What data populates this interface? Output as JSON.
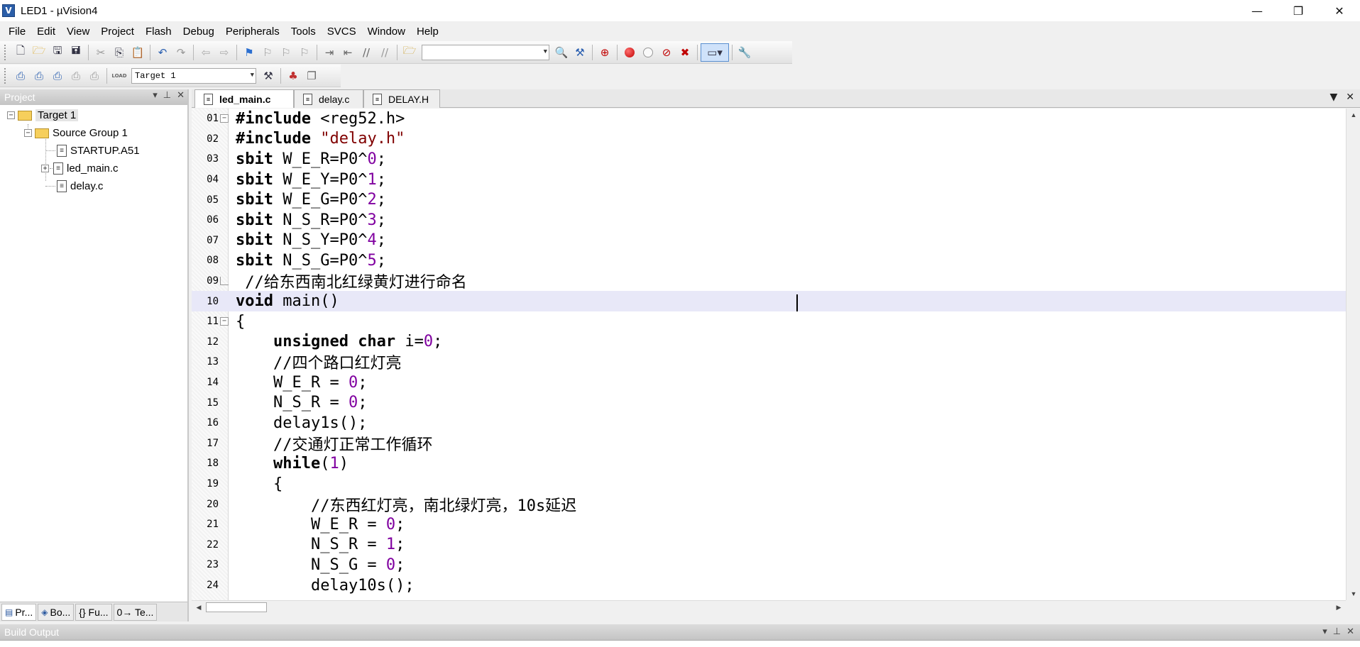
{
  "window": {
    "title": "LED1  - µVision4",
    "icon_letter": "V",
    "controls": {
      "minimize": "—",
      "restore": "❐",
      "close": "✕"
    }
  },
  "menu": [
    "File",
    "Edit",
    "View",
    "Project",
    "Flash",
    "Debug",
    "Peripherals",
    "Tools",
    "SVCS",
    "Window",
    "Help"
  ],
  "toolbar2": {
    "target_select": "Target 1",
    "load_label": "LOAD"
  },
  "project_panel": {
    "title": "Project",
    "tree": {
      "target": "Target 1",
      "group": "Source Group 1",
      "files": [
        "STARTUP.A51",
        "led_main.c",
        "delay.c"
      ]
    },
    "tabs": [
      "Pr...",
      "Bo...",
      "{} Fu...",
      "0→ Te..."
    ]
  },
  "editor": {
    "tabs": [
      "led_main.c",
      "delay.c",
      "DELAY.H"
    ],
    "active_tab": "led_main.c",
    "current_line": "10",
    "lines": [
      {
        "n": "01",
        "t": "#include <reg52.h>"
      },
      {
        "n": "02",
        "t": "#include \"delay.h\""
      },
      {
        "n": "03",
        "t": "sbit W_E_R=P0^0;"
      },
      {
        "n": "04",
        "t": "sbit W_E_Y=P0^1;"
      },
      {
        "n": "05",
        "t": "sbit W_E_G=P0^2;"
      },
      {
        "n": "06",
        "t": "sbit N_S_R=P0^3;"
      },
      {
        "n": "07",
        "t": "sbit N_S_Y=P0^4;"
      },
      {
        "n": "08",
        "t": "sbit N_S_G=P0^5;"
      },
      {
        "n": "09",
        "t": " //给东西南北红绿黄灯进行命名"
      },
      {
        "n": "10",
        "t": "void main()"
      },
      {
        "n": "11",
        "t": "{"
      },
      {
        "n": "12",
        "t": "    unsigned char i=0;"
      },
      {
        "n": "13",
        "t": "    //四个路口红灯亮"
      },
      {
        "n": "14",
        "t": "    W_E_R = 0;"
      },
      {
        "n": "15",
        "t": "    N_S_R = 0;"
      },
      {
        "n": "16",
        "t": "    delay1s();"
      },
      {
        "n": "17",
        "t": "    //交通灯正常工作循环"
      },
      {
        "n": "18",
        "t": "    while(1)"
      },
      {
        "n": "19",
        "t": "    {"
      },
      {
        "n": "20",
        "t": "        //东西红灯亮，南北绿灯亮，10s延迟"
      },
      {
        "n": "21",
        "t": "        W_E_R = 0;"
      },
      {
        "n": "22",
        "t": "        N_S_R = 1;"
      },
      {
        "n": "23",
        "t": "        N_S_G = 0;"
      },
      {
        "n": "24",
        "t": "        delay10s();"
      }
    ]
  },
  "build_output": {
    "title": "Build Output"
  }
}
